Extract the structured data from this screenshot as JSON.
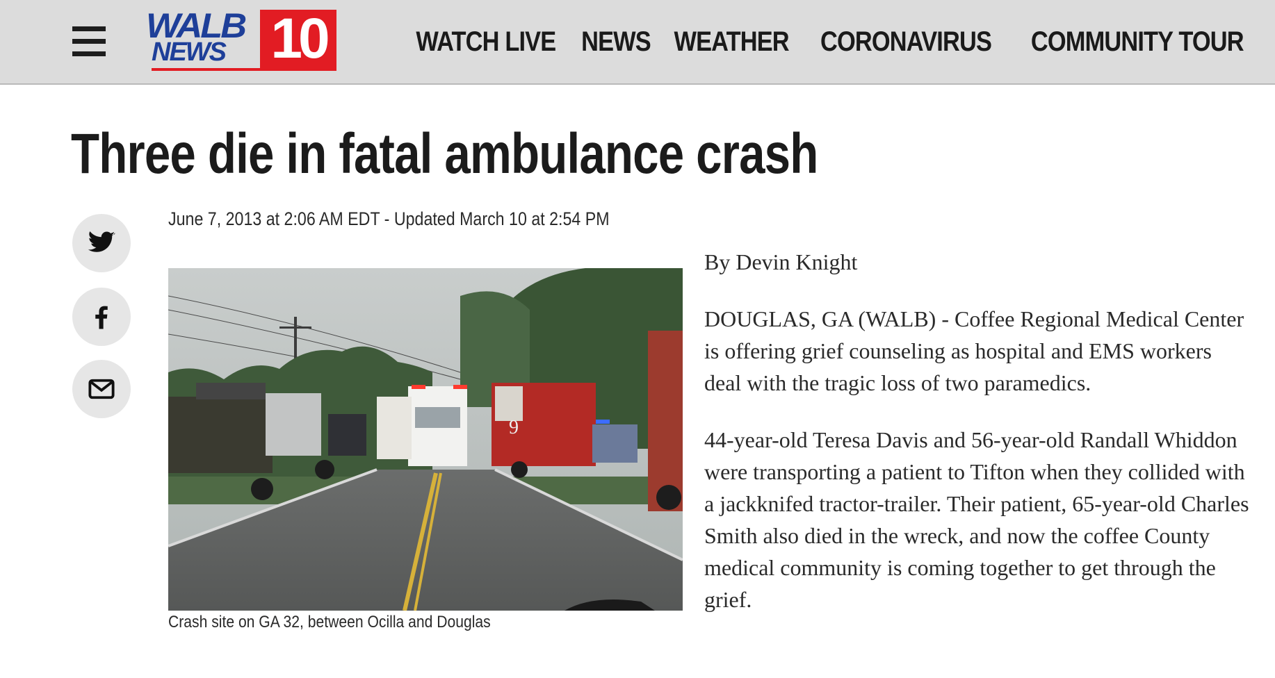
{
  "header": {
    "logo_walb": "WALB",
    "logo_news": "NEWS",
    "logo_number": "10",
    "nav": [
      "WATCH LIVE",
      "NEWS",
      "WEATHER",
      "CORONAVIRUS",
      "COMMUNITY TOUR"
    ]
  },
  "article": {
    "headline": "Three die in fatal ambulance crash",
    "dateline": "June 7, 2013 at 2:06 AM EDT - Updated March 10 at 2:54 PM",
    "caption": "Crash site on GA 32, between Ocilla and Douglas",
    "byline": "By Devin Knight",
    "paragraphs": [
      "DOUGLAS, GA (WALB) - Coffee Regional Medical Center is offering grief counseling as hospital and EMS workers deal with the tragic loss of two paramedics.",
      "44-year-old Teresa Davis and 56-year-old Randall Whiddon were transporting a patient to Tifton when they collided with a jackknifed tractor-trailer. Their patient, 65-year-old Charles Smith also died in the wreck, and now the coffee County medical community is coming together to get through the grief."
    ]
  },
  "share": [
    "twitter-icon",
    "facebook-icon",
    "email-icon"
  ],
  "colors": {
    "header_bg": "#dcdcdc",
    "brand_blue": "#1e3f99",
    "brand_red": "#e21c23"
  }
}
